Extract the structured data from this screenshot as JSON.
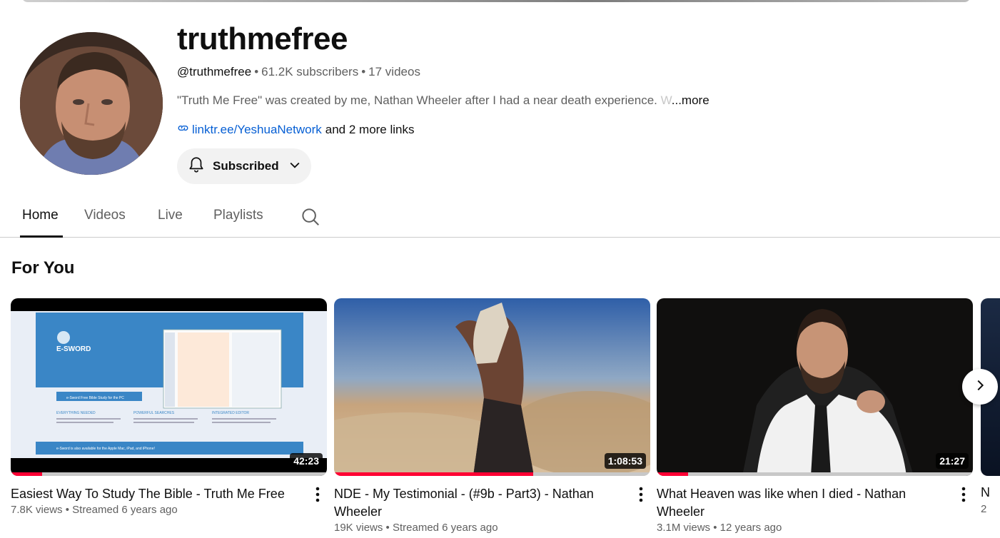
{
  "channel": {
    "name": "truthmefree",
    "handle": "@truthmefree",
    "subscribers": "61.2K subscribers",
    "videos_count": "17 videos",
    "description": "\"Truth Me Free\" was created by me, Nathan Wheeler after I had a near death experience.",
    "description_fade": " W",
    "more_label": "...more",
    "link": "linktr.ee/YeshuaNetwork",
    "more_links": "and 2 more links",
    "subscribe_label": "Subscribed"
  },
  "tabs": [
    {
      "label": "Home",
      "active": true
    },
    {
      "label": "Videos",
      "active": false
    },
    {
      "label": "Live",
      "active": false
    },
    {
      "label": "Playlists",
      "active": false
    }
  ],
  "section": {
    "title": "For You"
  },
  "videos": [
    {
      "title": "Easiest Way To Study The Bible - Truth Me Free",
      "views": "7.8K views",
      "age": "Streamed 6 years ago",
      "duration": "42:23",
      "watched": 0.1
    },
    {
      "title": "NDE - My Testimonial - (#9b - Part3) - Nathan Wheeler",
      "views": "19K views",
      "age": "Streamed 6 years ago",
      "duration": "1:08:53",
      "watched": 0.63
    },
    {
      "title": "What Heaven was like when I died - Nathan Wheeler",
      "views": "3.1M views",
      "age": "12 years ago",
      "duration": "21:27",
      "watched": 0.1
    }
  ],
  "partial_video": {
    "title_start": "N",
    "meta_start": "2"
  },
  "thumb_text": {
    "esword_logo": "E-SWORD",
    "esword_button": "e-Sword Free Bible Study for the PC",
    "esword_heading_1": "EVERYTHING NEEDED",
    "esword_heading_2": "POWERFUL SEARCHES",
    "esword_heading_3": "INTEGRATED EDITOR",
    "esword_footer": "e-Sword is also available for the Apple Mac, iPad, and iPhone!"
  },
  "icons": {
    "link": "link-icon",
    "bell": "bell-icon",
    "chevron": "chevron-down-icon",
    "search": "search-icon",
    "kebab": "more-vert-icon",
    "next": "chevron-right-icon"
  },
  "colors": {
    "link": "#065fd4",
    "progress": "#ff0033",
    "button_bg": "#f2f2f2"
  }
}
